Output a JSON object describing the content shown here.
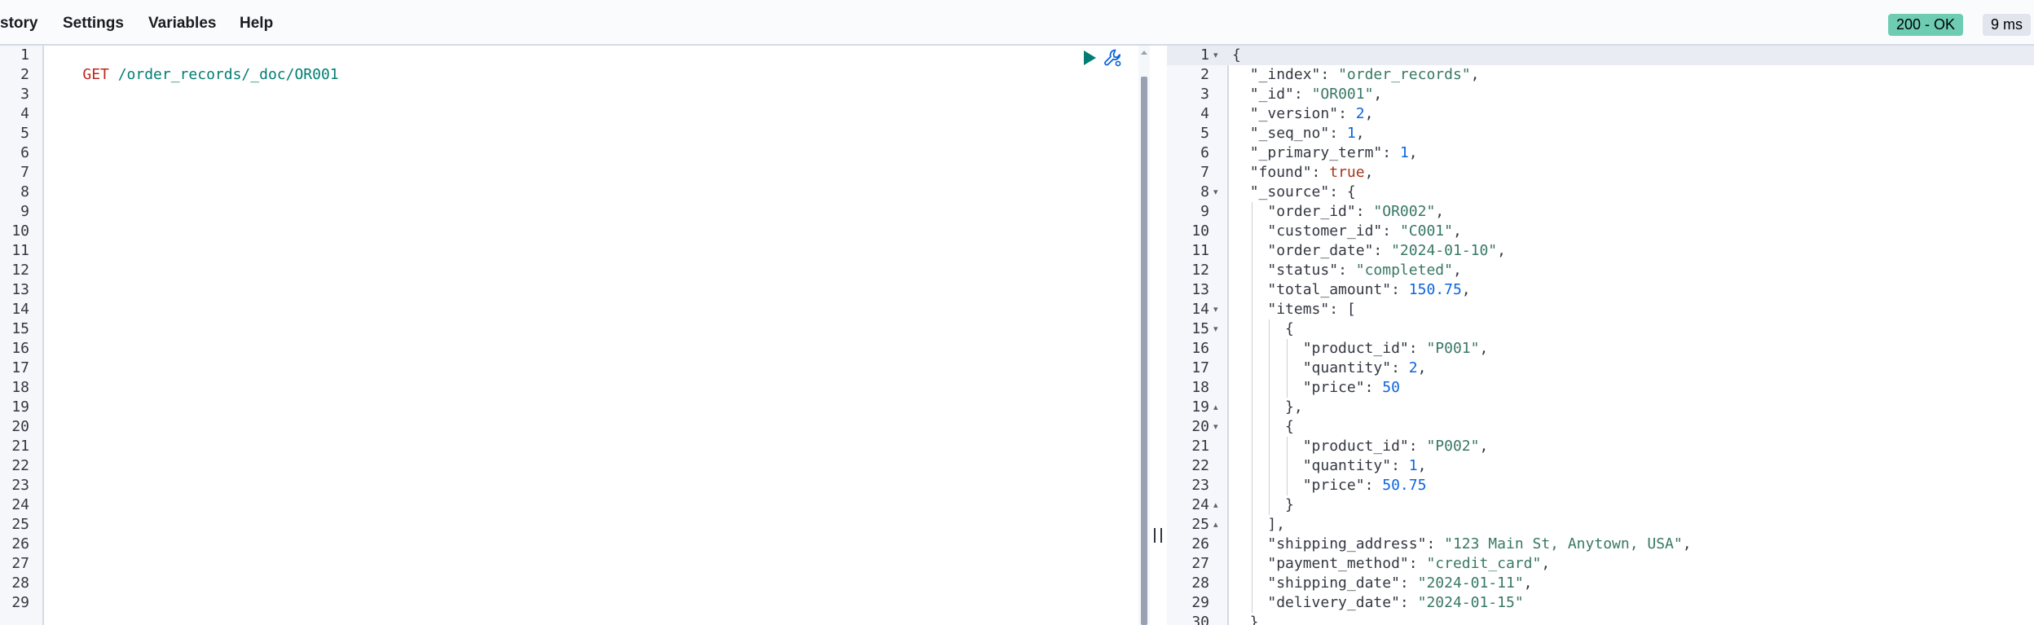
{
  "menu": {
    "items": [
      "story",
      "Settings",
      "Variables",
      "Help"
    ]
  },
  "status": {
    "code_label": "200 - OK",
    "time_label": "9 ms",
    "ok_color": "#6dccb1",
    "time_bg": "#e0e5ee"
  },
  "request": {
    "method": "GET",
    "url": " /order_records/_doc/OR001",
    "line_count": 29,
    "icons": [
      "play-icon",
      "wrench-icon"
    ]
  },
  "response": {
    "line_count": 30,
    "lines": [
      [
        [
          "p",
          "{"
        ]
      ],
      [
        [
          "p",
          "  "
        ],
        [
          "k",
          "\"_index\""
        ],
        [
          "p",
          ": "
        ],
        [
          "s",
          "\"order_records\""
        ],
        [
          "p",
          ","
        ]
      ],
      [
        [
          "p",
          "  "
        ],
        [
          "k",
          "\"_id\""
        ],
        [
          "p",
          ": "
        ],
        [
          "s",
          "\"OR001\""
        ],
        [
          "p",
          ","
        ]
      ],
      [
        [
          "p",
          "  "
        ],
        [
          "k",
          "\"_version\""
        ],
        [
          "p",
          ": "
        ],
        [
          "n",
          "2"
        ],
        [
          "p",
          ","
        ]
      ],
      [
        [
          "p",
          "  "
        ],
        [
          "k",
          "\"_seq_no\""
        ],
        [
          "p",
          ": "
        ],
        [
          "n",
          "1"
        ],
        [
          "p",
          ","
        ]
      ],
      [
        [
          "p",
          "  "
        ],
        [
          "k",
          "\"_primary_term\""
        ],
        [
          "p",
          ": "
        ],
        [
          "n",
          "1"
        ],
        [
          "p",
          ","
        ]
      ],
      [
        [
          "p",
          "  "
        ],
        [
          "k",
          "\"found\""
        ],
        [
          "p",
          ": "
        ],
        [
          "b",
          "true"
        ],
        [
          "p",
          ","
        ]
      ],
      [
        [
          "p",
          "  "
        ],
        [
          "k",
          "\"_source\""
        ],
        [
          "p",
          ": {"
        ]
      ],
      [
        [
          "p",
          "    "
        ],
        [
          "k",
          "\"order_id\""
        ],
        [
          "p",
          ": "
        ],
        [
          "s",
          "\"OR002\""
        ],
        [
          "p",
          ","
        ]
      ],
      [
        [
          "p",
          "    "
        ],
        [
          "k",
          "\"customer_id\""
        ],
        [
          "p",
          ": "
        ],
        [
          "s",
          "\"C001\""
        ],
        [
          "p",
          ","
        ]
      ],
      [
        [
          "p",
          "    "
        ],
        [
          "k",
          "\"order_date\""
        ],
        [
          "p",
          ": "
        ],
        [
          "s",
          "\"2024-01-10\""
        ],
        [
          "p",
          ","
        ]
      ],
      [
        [
          "p",
          "    "
        ],
        [
          "k",
          "\"status\""
        ],
        [
          "p",
          ": "
        ],
        [
          "s",
          "\"completed\""
        ],
        [
          "p",
          ","
        ]
      ],
      [
        [
          "p",
          "    "
        ],
        [
          "k",
          "\"total_amount\""
        ],
        [
          "p",
          ": "
        ],
        [
          "n",
          "150.75"
        ],
        [
          "p",
          ","
        ]
      ],
      [
        [
          "p",
          "    "
        ],
        [
          "k",
          "\"items\""
        ],
        [
          "p",
          ": ["
        ]
      ],
      [
        [
          "p",
          "      {"
        ]
      ],
      [
        [
          "p",
          "        "
        ],
        [
          "k",
          "\"product_id\""
        ],
        [
          "p",
          ": "
        ],
        [
          "s",
          "\"P001\""
        ],
        [
          "p",
          ","
        ]
      ],
      [
        [
          "p",
          "        "
        ],
        [
          "k",
          "\"quantity\""
        ],
        [
          "p",
          ": "
        ],
        [
          "n",
          "2"
        ],
        [
          "p",
          ","
        ]
      ],
      [
        [
          "p",
          "        "
        ],
        [
          "k",
          "\"price\""
        ],
        [
          "p",
          ": "
        ],
        [
          "n",
          "50"
        ]
      ],
      [
        [
          "p",
          "      },"
        ]
      ],
      [
        [
          "p",
          "      {"
        ]
      ],
      [
        [
          "p",
          "        "
        ],
        [
          "k",
          "\"product_id\""
        ],
        [
          "p",
          ": "
        ],
        [
          "s",
          "\"P002\""
        ],
        [
          "p",
          ","
        ]
      ],
      [
        [
          "p",
          "        "
        ],
        [
          "k",
          "\"quantity\""
        ],
        [
          "p",
          ": "
        ],
        [
          "n",
          "1"
        ],
        [
          "p",
          ","
        ]
      ],
      [
        [
          "p",
          "        "
        ],
        [
          "k",
          "\"price\""
        ],
        [
          "p",
          ": "
        ],
        [
          "n",
          "50.75"
        ]
      ],
      [
        [
          "p",
          "      }"
        ]
      ],
      [
        [
          "p",
          "    ],"
        ]
      ],
      [
        [
          "p",
          "    "
        ],
        [
          "k",
          "\"shipping_address\""
        ],
        [
          "p",
          ": "
        ],
        [
          "s",
          "\"123 Main St, Anytown, USA\""
        ],
        [
          "p",
          ","
        ]
      ],
      [
        [
          "p",
          "    "
        ],
        [
          "k",
          "\"payment_method\""
        ],
        [
          "p",
          ": "
        ],
        [
          "s",
          "\"credit_card\""
        ],
        [
          "p",
          ","
        ]
      ],
      [
        [
          "p",
          "    "
        ],
        [
          "k",
          "\"shipping_date\""
        ],
        [
          "p",
          ": "
        ],
        [
          "s",
          "\"2024-01-11\""
        ],
        [
          "p",
          ","
        ]
      ],
      [
        [
          "p",
          "    "
        ],
        [
          "k",
          "\"delivery_date\""
        ],
        [
          "p",
          ": "
        ],
        [
          "s",
          "\"2024-01-15\""
        ]
      ],
      [
        [
          "p",
          "  }"
        ]
      ]
    ],
    "folds": [
      {
        "line": 1,
        "dir": "open"
      },
      {
        "line": 8,
        "dir": "open"
      },
      {
        "line": 14,
        "dir": "open"
      },
      {
        "line": 15,
        "dir": "open"
      },
      {
        "line": 19,
        "dir": "close"
      },
      {
        "line": 20,
        "dir": "open"
      },
      {
        "line": 24,
        "dir": "close"
      },
      {
        "line": 25,
        "dir": "close"
      }
    ]
  }
}
